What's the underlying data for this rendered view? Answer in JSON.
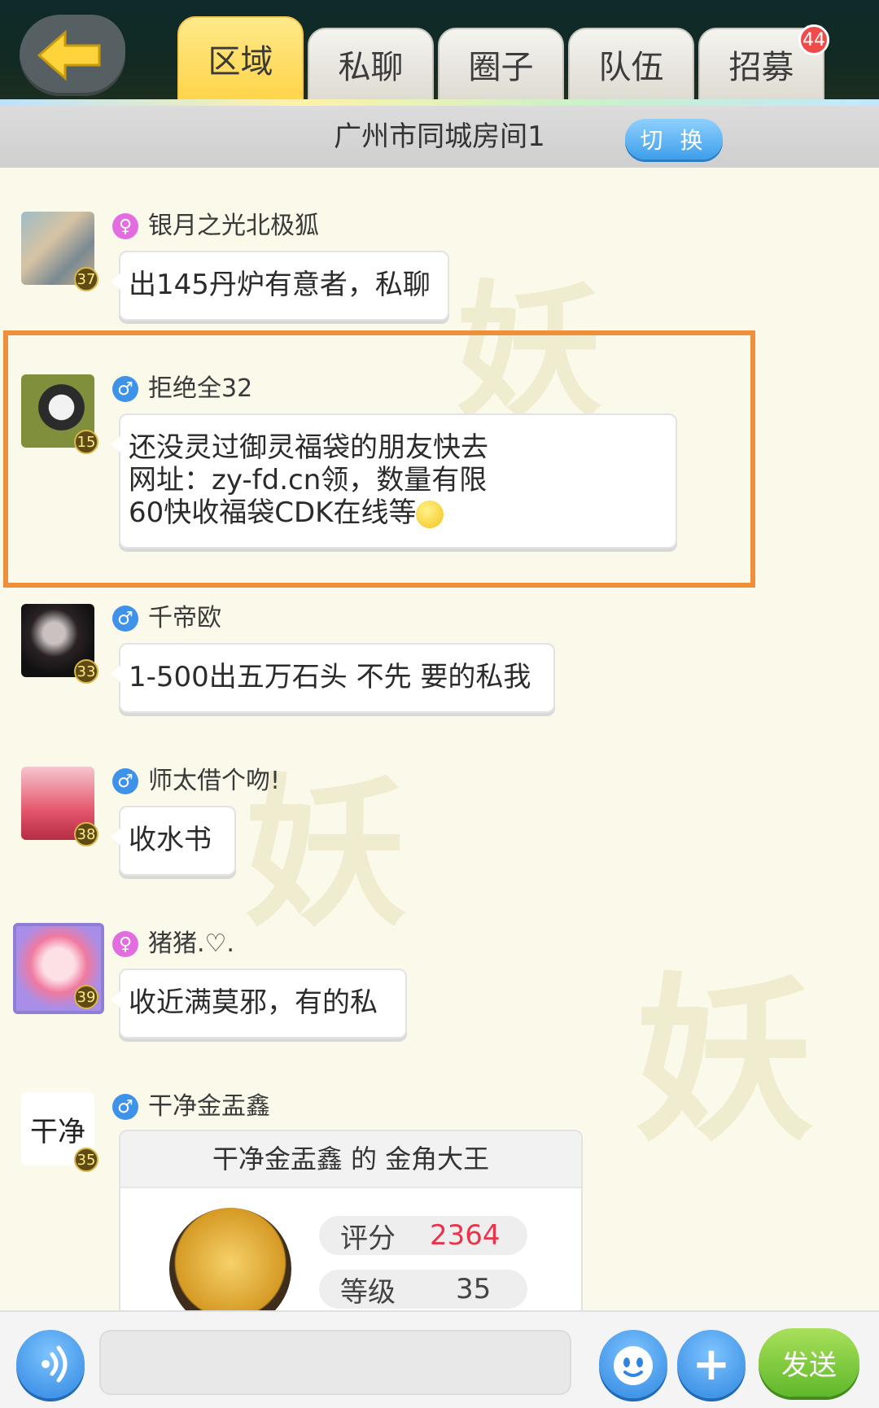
{
  "header": {
    "back_icon": "back-arrow-icon",
    "tabs": [
      {
        "label": "区域",
        "active": true
      },
      {
        "label": "私聊",
        "active": false
      },
      {
        "label": "圈子",
        "active": false
      },
      {
        "label": "队伍",
        "active": false
      },
      {
        "label": "招募",
        "active": false,
        "badge": "44"
      }
    ]
  },
  "room": {
    "title": "广州市同城房间1",
    "switch_label": "切 换"
  },
  "messages": [
    {
      "gender": "female",
      "gender_symbol": "♀",
      "name": "银月之光北极狐",
      "level": "37",
      "lines": [
        "出145丹炉有意者，私聊"
      ]
    },
    {
      "gender": "male",
      "gender_symbol": "♂",
      "name": "拒绝全32",
      "level": "15",
      "lines": [
        "还没灵过御灵福袋的朋友快去",
        "网址：zy-fd.cn领，数量有限",
        "60快收福袋CDK在线等"
      ],
      "highlighted": true
    },
    {
      "gender": "male",
      "gender_symbol": "♂",
      "name": "千帝欧",
      "level": "33",
      "lines": [
        "1-500出五万石头 不先 要的私我"
      ]
    },
    {
      "gender": "male",
      "gender_symbol": "♂",
      "name": "师太借个吻!",
      "level": "38",
      "lines": [
        "收水书"
      ]
    },
    {
      "gender": "female",
      "gender_symbol": "♀",
      "name": "猪猪.♡.",
      "level": "39",
      "lines": [
        "收近满莫邪，有的私"
      ]
    },
    {
      "gender": "male",
      "gender_symbol": "♂",
      "name": "干净金盂鑫",
      "level": "35",
      "avatar_text": "干净"
    }
  ],
  "card": {
    "title": "干净金盂鑫 的 金角大王",
    "score_label": "评分",
    "score_value": "2364",
    "level_label": "等级",
    "level_value": "35"
  },
  "bottom": {
    "voice_icon": "voice-icon",
    "emoji_icon": "emoji-icon",
    "plus_label": "+",
    "send_label": "发送"
  },
  "colors": {
    "highlight_border": "#f08f3a",
    "active_tab": "#ffd54a",
    "score_value": "#e8334a"
  }
}
